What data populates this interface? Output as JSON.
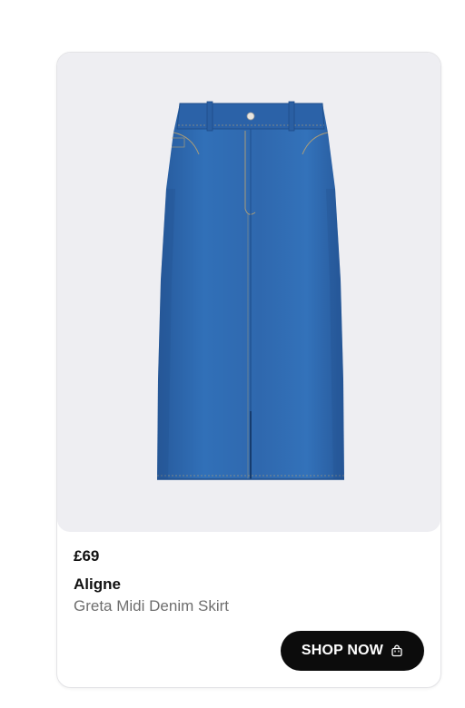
{
  "product": {
    "price": "£69",
    "brand": "Aligne",
    "name": "Greta Midi Denim Skirt",
    "image_alt": "denim-midi-skirt-image"
  },
  "cta": {
    "label": "SHOP NOW",
    "icon": "shopping-bag-icon"
  },
  "colors": {
    "denim": "#2f66ad",
    "image_background": "#eeeef2",
    "button_background": "#0c0c0c",
    "button_text": "#ffffff",
    "secondary_text": "#6e6e6e"
  }
}
